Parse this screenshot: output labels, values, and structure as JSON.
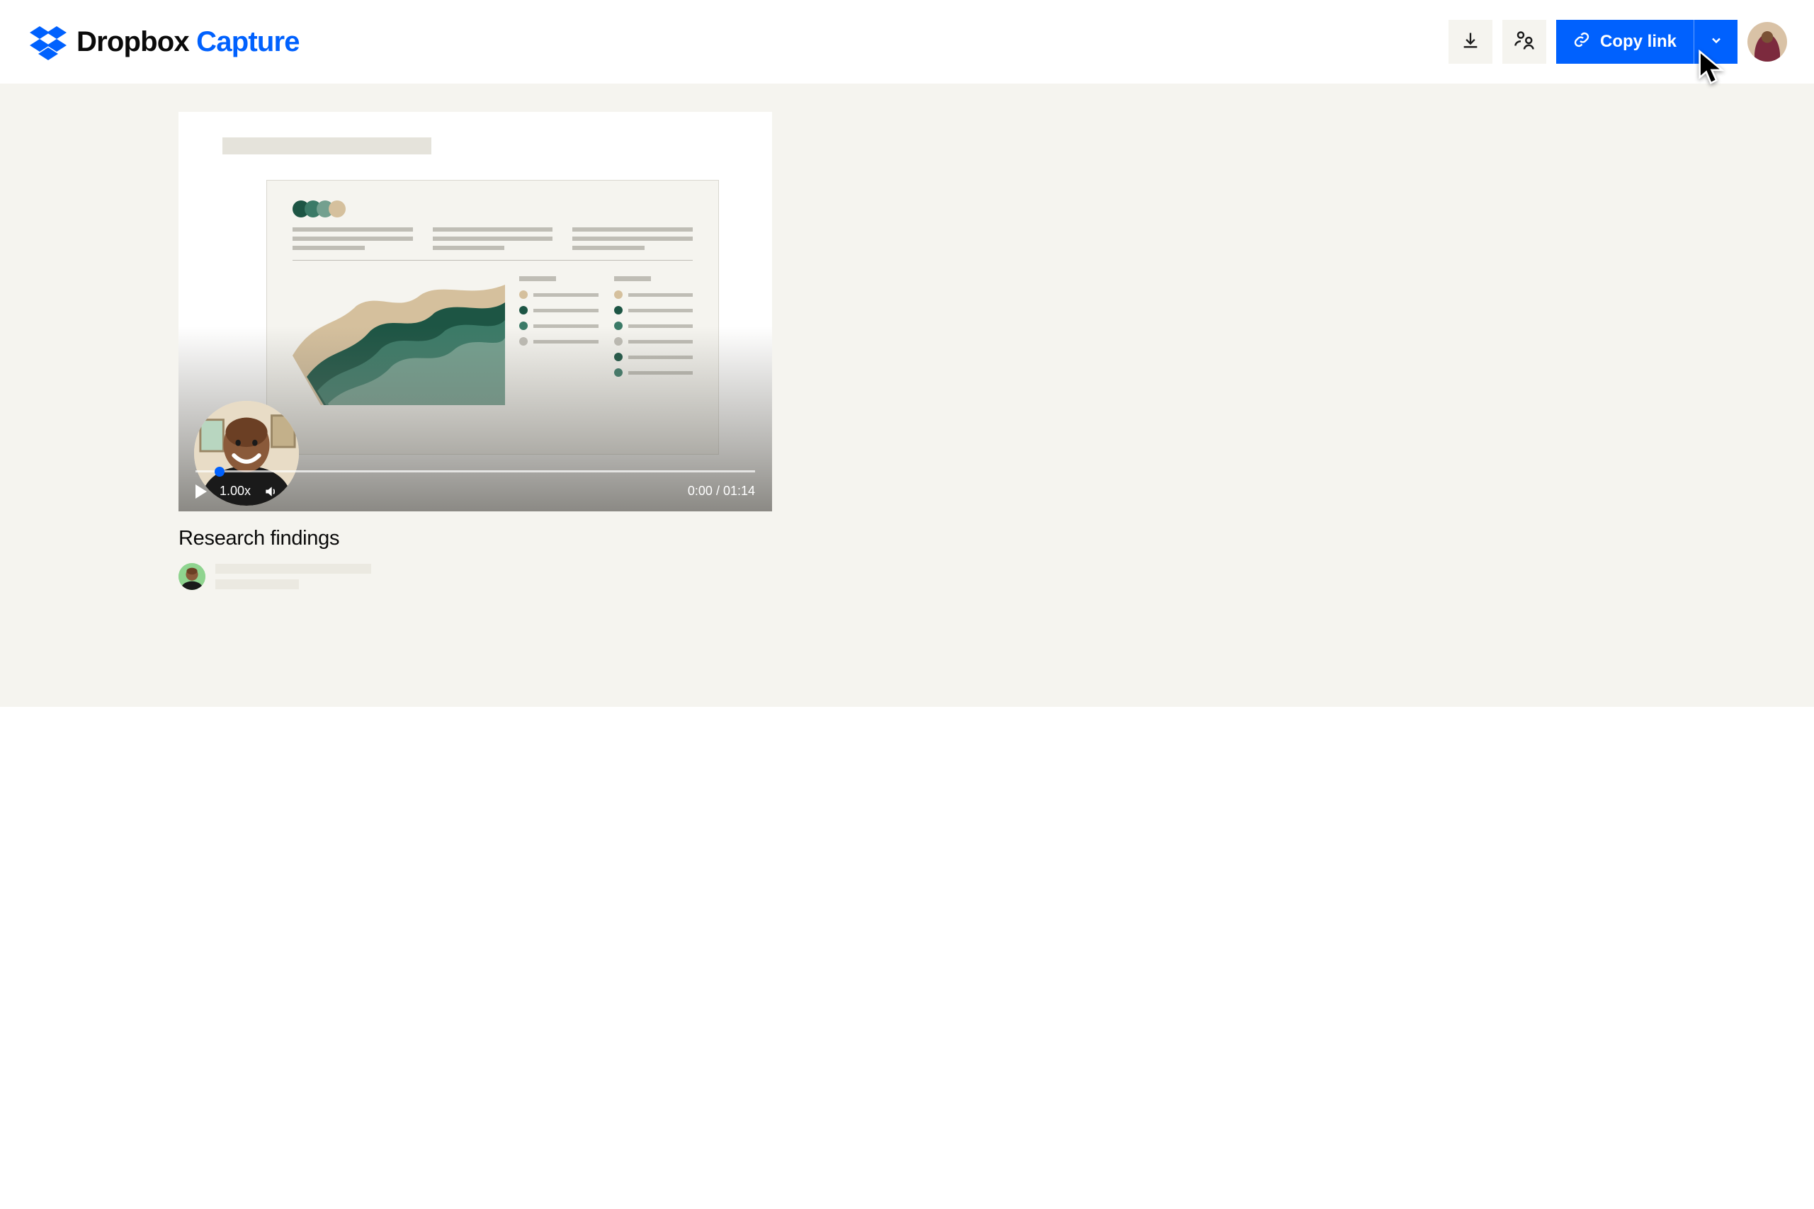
{
  "header": {
    "brand": "Dropbox",
    "product": "Capture",
    "copy_link_label": "Copy link"
  },
  "player": {
    "speed_label": "1.00x",
    "time_current": "0:00",
    "time_separator": " / ",
    "time_total": "01:14"
  },
  "video": {
    "title": "Research findings"
  },
  "colors": {
    "blue": "#0061fe"
  }
}
